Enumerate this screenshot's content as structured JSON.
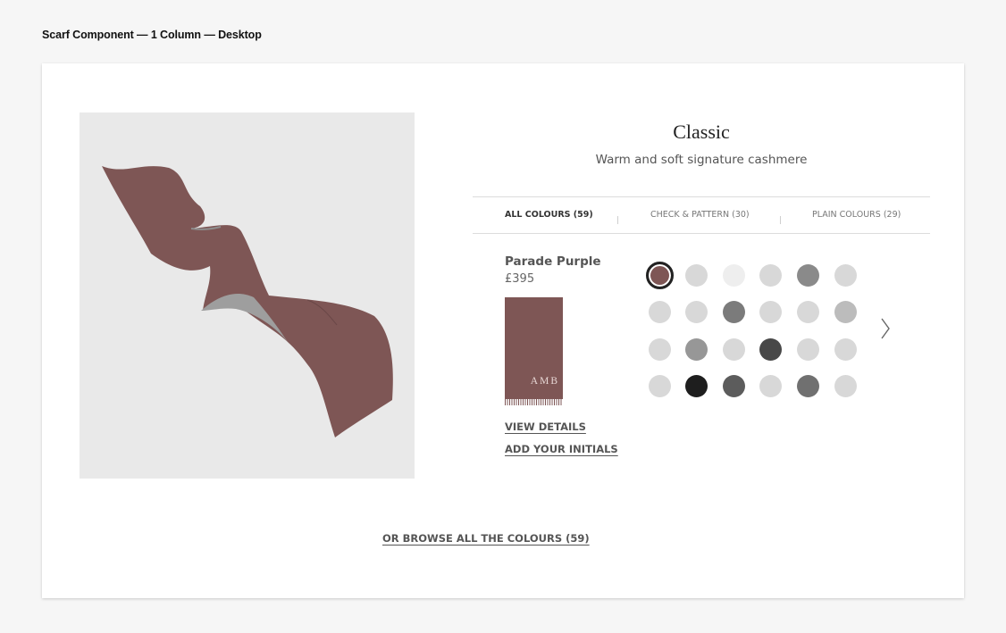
{
  "page": {
    "caption": "Scarf Component — 1 Column — Desktop"
  },
  "product": {
    "title": "Classic",
    "subtitle": "Warm and soft signature cashmere",
    "image_icon": "scarf-illustration",
    "image_colour": "#7e5655"
  },
  "tabs": [
    {
      "label": "ALL COLOURS (59)",
      "active": true
    },
    {
      "label": "CHECK & PATTERN (30)",
      "active": false
    },
    {
      "label": "PLAIN COLOURS (29)",
      "active": false
    }
  ],
  "selected_colour": {
    "name": "Parade Purple",
    "price": "£395",
    "initials": "AMB",
    "hex": "#7e5655"
  },
  "links": {
    "view_details": "VIEW DETAILS",
    "add_initials": "ADD YOUR INITIALS",
    "browse_all": "OR BROWSE ALL THE COLOURS (59)"
  },
  "swatches": [
    [
      "#7e5655",
      "#d8d8d8",
      "#eeeeee",
      "#d8d8d8",
      "#8a8a8a",
      "#d8d8d8"
    ],
    [
      "#d8d8d8",
      "#d8d8d8",
      "#7b7b7b",
      "#d8d8d8",
      "#d8d8d8",
      "#bcbcbc"
    ],
    [
      "#d8d8d8",
      "#979797",
      "#d8d8d8",
      "#484848",
      "#d8d8d8",
      "#d8d8d8"
    ],
    [
      "#d8d8d8",
      "#1e1e1e",
      "#5c5c5c",
      "#d8d8d8",
      "#707070",
      "#d8d8d8"
    ]
  ],
  "selected_swatch": [
    0,
    0
  ],
  "icons": {
    "next": "chevron-right-icon"
  }
}
